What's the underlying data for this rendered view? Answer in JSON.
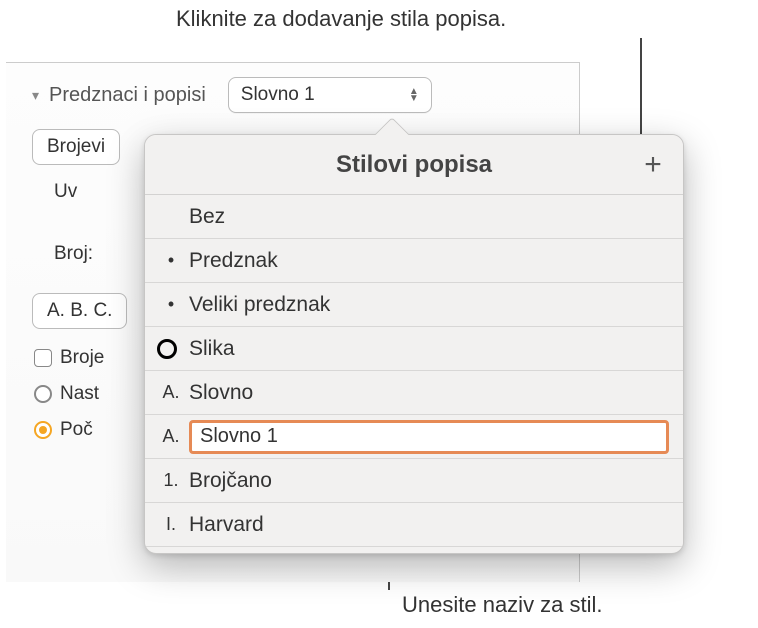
{
  "callouts": {
    "top": "Kliknite za dodavanje stila popisa.",
    "bottom": "Unesite naziv za stil."
  },
  "sidebar": {
    "section_label": "Predznaci i popisi",
    "style_dropdown_value": "Slovno 1",
    "tab_label": "Brojevi",
    "indent_label": "Uv",
    "number_label": "Broj:",
    "abc_label": "A. B. C.",
    "check_label": "Broje",
    "radio1": "Nast",
    "radio2": "Poč"
  },
  "popup": {
    "title": "Stilovi popisa",
    "add_glyph": "+",
    "items": [
      {
        "glyph": "",
        "label": "Bez"
      },
      {
        "glyph": "•",
        "label": "Predznak"
      },
      {
        "glyph": "•",
        "label": "Veliki predznak"
      },
      {
        "glyph": "○",
        "label": "Slika",
        "circle": true
      },
      {
        "glyph": "A.",
        "label": "Slovno"
      },
      {
        "glyph": "A.",
        "label": "Slovno 1",
        "editing": true
      },
      {
        "glyph": "1.",
        "label": "Brojčano"
      },
      {
        "glyph": "I.",
        "label": "Harvard"
      }
    ]
  }
}
